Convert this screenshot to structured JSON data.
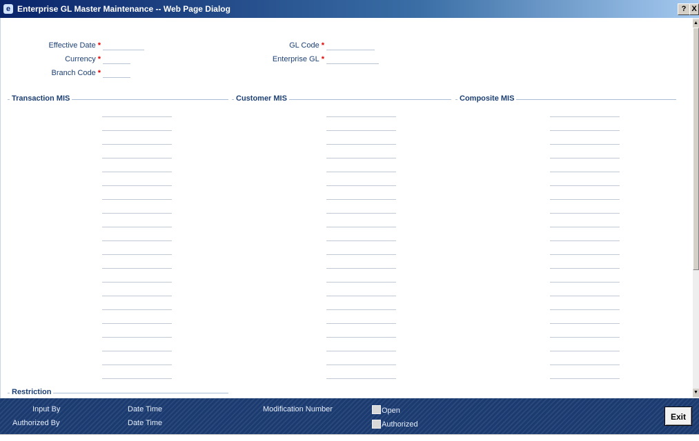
{
  "window": {
    "title": "Enterprise GL Master Maintenance -- Web Page Dialog",
    "help_label": "?",
    "close_label": "X"
  },
  "form": {
    "effective_date": {
      "label": "Effective Date",
      "value": ""
    },
    "currency": {
      "label": "Currency",
      "value": ""
    },
    "branch_code": {
      "label": "Branch Code",
      "value": ""
    },
    "gl_code": {
      "label": "GL Code",
      "value": ""
    },
    "enterprise_gl": {
      "label": "Enterprise GL",
      "value": ""
    },
    "required_marker": "*"
  },
  "sections": {
    "transaction_mis": "Transaction MIS",
    "customer_mis": "Customer MIS",
    "composite_mis": "Composite MIS",
    "restriction": "Restriction"
  },
  "footer": {
    "input_by": "Input By",
    "date_time_1": "Date Time",
    "authorized_by": "Authorized By",
    "date_time_2": "Date Time",
    "modification_number": "Modification Number",
    "open": "Open",
    "authorized": "Authorized",
    "exit": "Exit"
  }
}
